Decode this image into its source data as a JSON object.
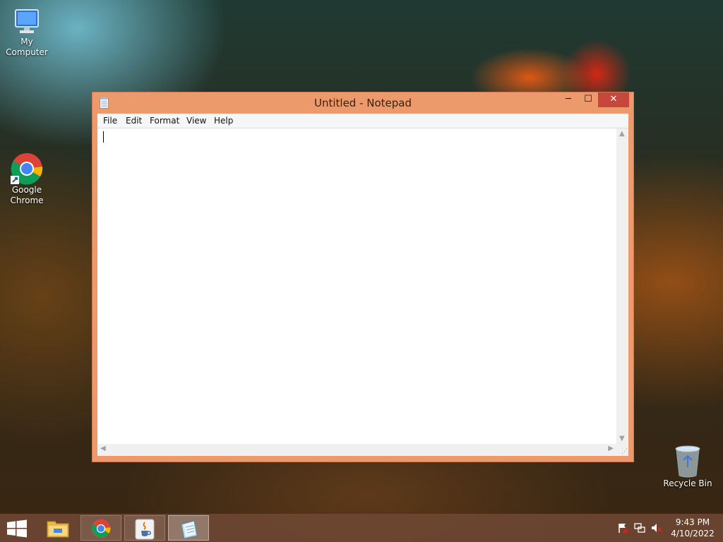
{
  "desktop": {
    "icons": [
      {
        "label": "My Computer"
      },
      {
        "label": "Google Chrome"
      },
      {
        "label": "Recycle Bin"
      }
    ]
  },
  "window": {
    "title": "Untitled - Notepad",
    "controls": {
      "minimize": "─",
      "maximize": "☐",
      "close": "✕"
    },
    "menu": [
      "File",
      "Edit",
      "Format",
      "View",
      "Help"
    ],
    "content": ""
  },
  "taskbar": {
    "apps": [
      "file-explorer-icon",
      "chrome-icon",
      "java-icon",
      "notepad-icon"
    ],
    "active_app": "notepad-icon",
    "clock": {
      "time": "9:43 PM",
      "date": "4/10/2022"
    }
  },
  "colors": {
    "window_frame": "#ec9a6c",
    "close_button": "#c7463d"
  }
}
